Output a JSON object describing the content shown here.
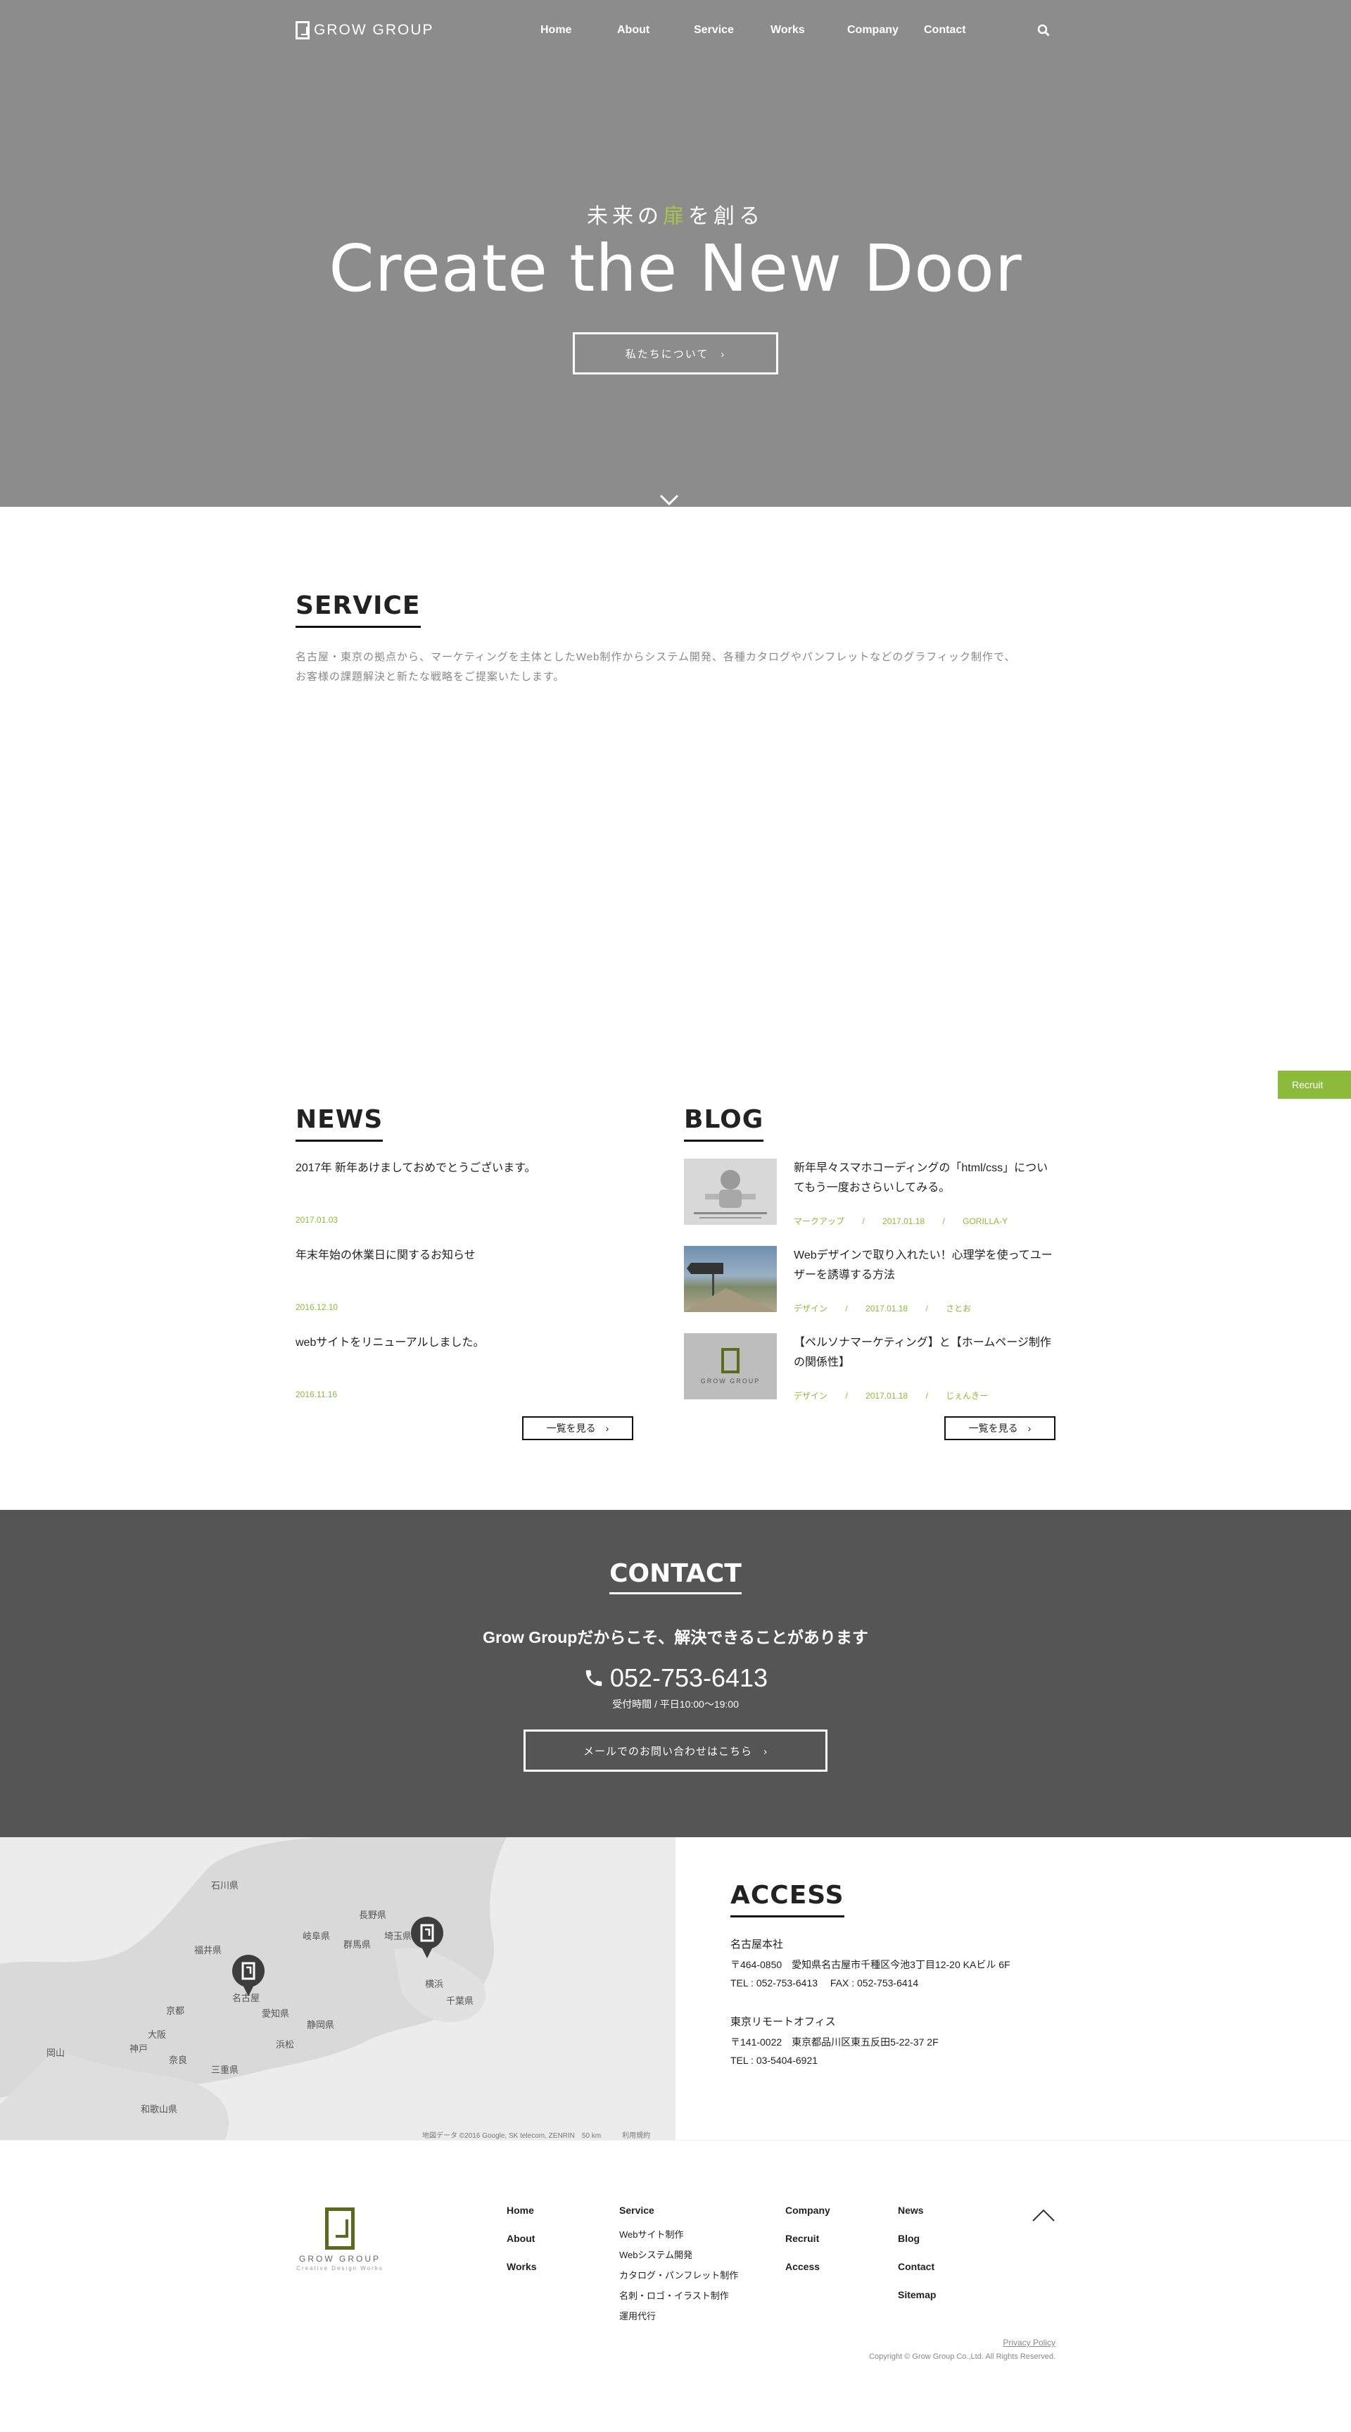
{
  "header": {
    "logo_text": "GROW GROUP",
    "nav": [
      "Home",
      "About",
      "Service",
      "Works",
      "Company",
      "Contact"
    ]
  },
  "hero": {
    "subtitle_before": "未来の",
    "subtitle_highlight": "扉",
    "subtitle_after": "を創る",
    "title": "Create the New Door",
    "button_label": "私たちについて　›"
  },
  "service": {
    "title": "SERVICE",
    "text_line1": "名古屋・東京の拠点から、マーケティングを主体としたWeb制作からシステム開発、各種カタログやパンフレットなどのグラフィック制作で、",
    "text_line2": "お客様の課題解決と新たな戦略をご提案いたします。"
  },
  "recruit_tab": "Recruit",
  "news": {
    "title": "NEWS",
    "items": [
      {
        "title": "2017年 新年あけましておめでとうございます。",
        "date": "2017.01.03"
      },
      {
        "title": "年末年始の休業日に関するお知らせ",
        "date": "2016.12.10"
      },
      {
        "title": "webサイトをリニューアルしました。",
        "date": "2016.11.16"
      }
    ],
    "more_label": "一覧を見る　›"
  },
  "blog": {
    "title": "BLOG",
    "items": [
      {
        "title_l1": "新年早々スマホコーディングの「html/css」につい",
        "title_l2": "てもう一度おさらいしてみる。",
        "category": "マークアップ",
        "date": "2017.01.18",
        "author": "GORILLA-Y"
      },
      {
        "title_l1": "Webデザインで取り入れたい！心理学を使ってユー",
        "title_l2": "ザーを誘導する方法",
        "category": "デザイン",
        "date": "2017.01.18",
        "author": "さとお"
      },
      {
        "title_l1": "【ペルソナマーケティング】と【ホームページ制作",
        "title_l2": "の関係性】",
        "category": "デザイン",
        "date": "2017.01.18",
        "author": "じぇんきー"
      }
    ],
    "thumb3_text": "GROW GROUP",
    "separator": "/",
    "more_label": "一覧を見る　›"
  },
  "contact": {
    "title": "CONTACT",
    "tagline": "Grow Groupだからこそ、解決できることがあります",
    "phone": "052-753-6413",
    "hours": "受付時間 / 平日10:00〜19:00",
    "button_label": "メールでのお問い合わせはこちら　›"
  },
  "map": {
    "cities": [
      "石川県",
      "福井県",
      "岐阜県",
      "長野県",
      "京都",
      "大阪",
      "神戸",
      "名古屋",
      "浜松",
      "静岡県",
      "横浜",
      "千葉県",
      "群馬県",
      "埼玉県",
      "岡山",
      "愛知県",
      "三重県",
      "奈良",
      "和歌山県"
    ],
    "attribution": "地図データ ©2016 Google, SK telecom, ZENRIN　50 km　　　利用規約"
  },
  "access": {
    "title": "ACCESS",
    "offices": [
      {
        "name": "名古屋本社",
        "address": "〒464-0850　愛知県名古屋市千種区今池3丁目12-20 KAビル 6F",
        "tel": "TEL : 052-753-6413　 FAX : 052-753-6414"
      },
      {
        "name": "東京リモートオフィス",
        "address": "〒141-0022　東京都品川区東五反田5-22-37 2F",
        "tel": "TEL : 03-5404-6921"
      }
    ]
  },
  "footer": {
    "logo_text": "GROW GROUP",
    "logo_sub": "Creative Design Works",
    "col1": [
      "Home",
      "About",
      "Works"
    ],
    "col2_title": "Service",
    "col2_items": [
      "Webサイト制作",
      "Webシステム開発",
      "カタログ・パンフレット制作",
      "名刺・ロゴ・イラスト制作",
      "運用代行"
    ],
    "col3": [
      "Company",
      "Recruit",
      "Access"
    ],
    "col4": [
      "News",
      "Blog",
      "Contact",
      "Sitemap"
    ],
    "privacy": "Privacy Policy",
    "copyright": "Copyright © Grow Group Co.,Ltd. All Rights Reserved."
  },
  "colors": {
    "accent": "#8cba3a",
    "hero_bg": "#8c8c8c",
    "contact_bg": "#555555",
    "logo_green": "#5a6a1e"
  }
}
